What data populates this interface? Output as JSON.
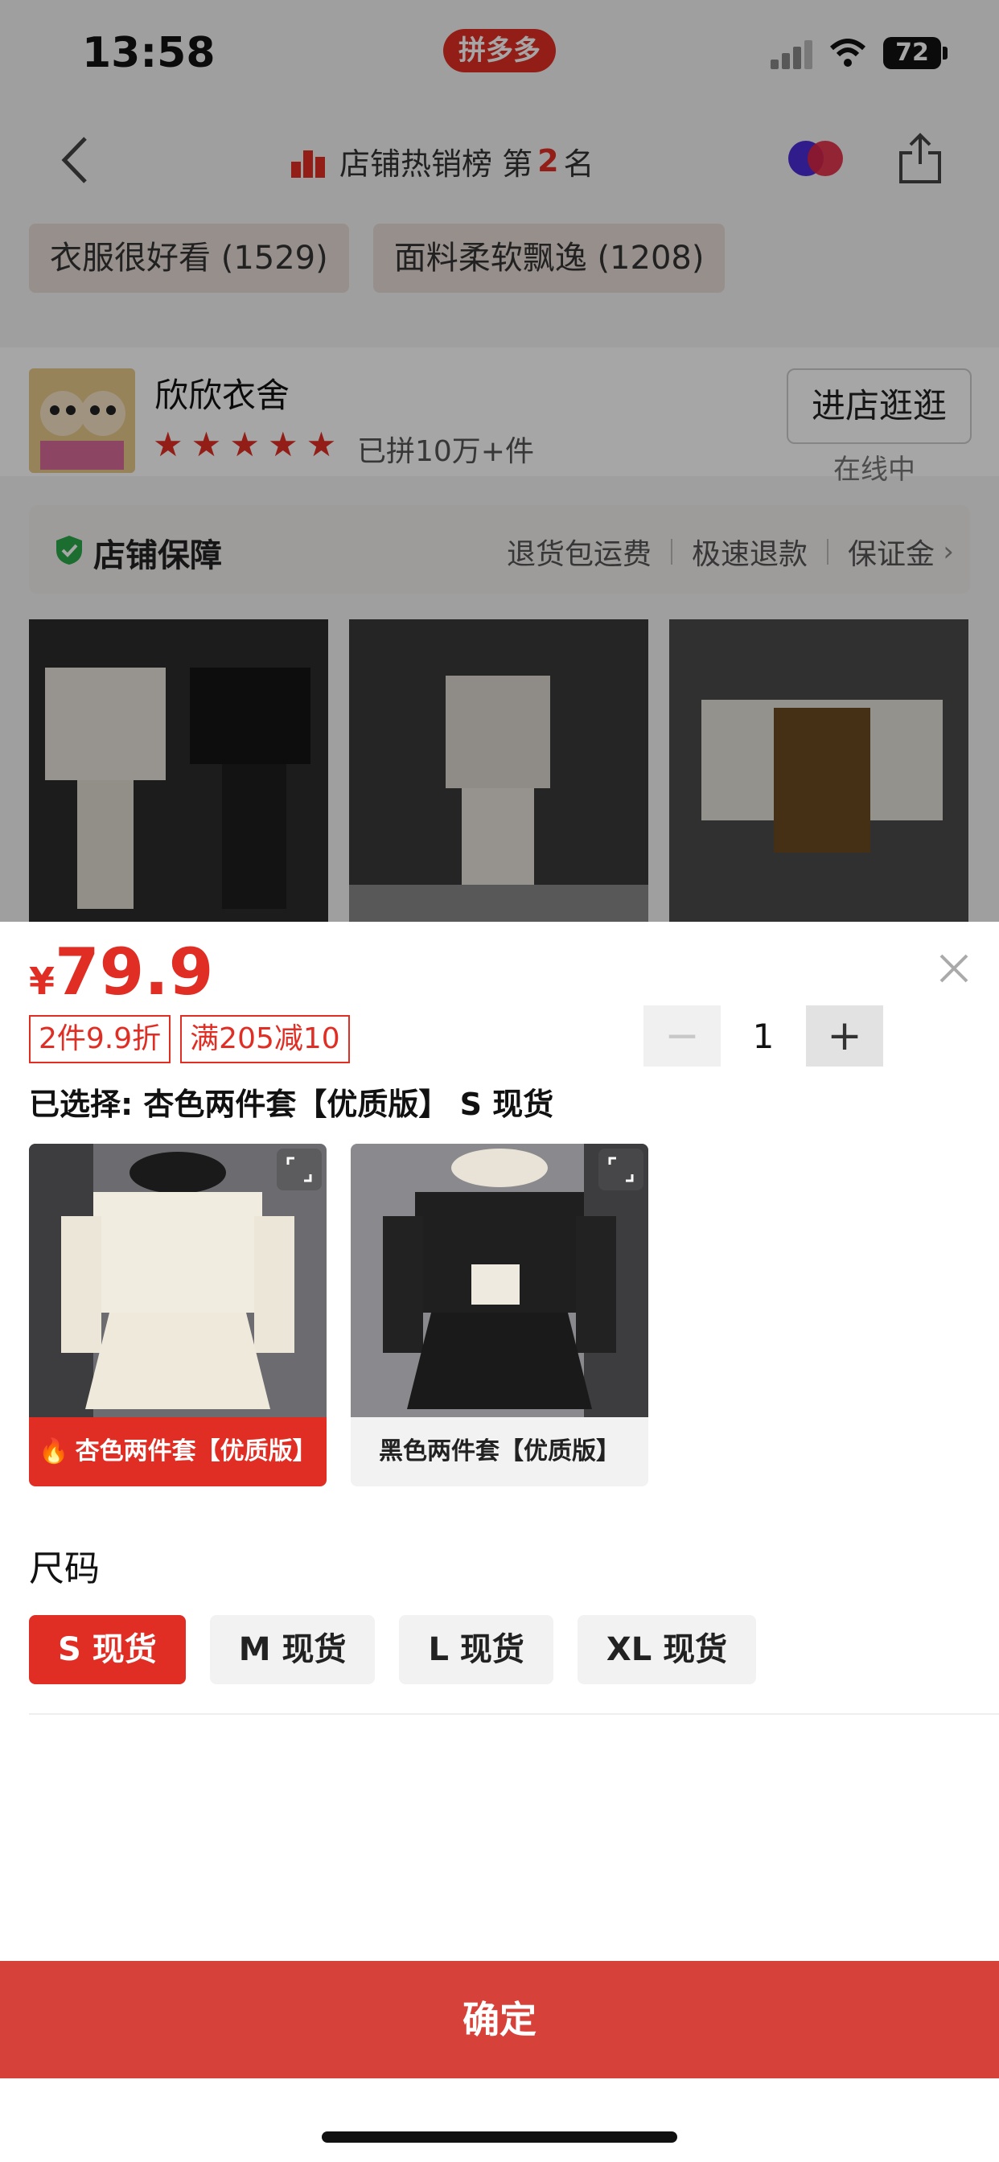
{
  "status_bar": {
    "time": "13:58",
    "app_badge": "拼多多",
    "battery": "72"
  },
  "nav": {
    "rank_label": "店铺热销榜 第",
    "rank_number": "2",
    "rank_suffix": "名"
  },
  "tags": [
    "衣服很好看 (1529)",
    "面料柔软飘逸 (1208)"
  ],
  "shop": {
    "name": "欣欣衣舍",
    "sold": "已拼10万+件",
    "enter_label": "进店逛逛",
    "online_label": "在线中",
    "rating_stars": 5
  },
  "guarantee": {
    "title": "店铺保障",
    "items": [
      "退货包运费",
      "极速退款",
      "保证金"
    ]
  },
  "sheet": {
    "currency": "¥",
    "price": "79.9",
    "promos": [
      "2件9.9折",
      "满205减10"
    ],
    "quantity": "1",
    "minus": "−",
    "plus": "+",
    "selected_text": "已选择: 杏色两件套【优质版】 S 现货",
    "variants": [
      {
        "label": "杏色两件套【优质版】",
        "state": "selected"
      },
      {
        "label": "黑色两件套【优质版】",
        "state": "unselected"
      }
    ],
    "size_title": "尺码",
    "sizes": [
      "S 现货",
      "M 现货",
      "L 现货",
      "XL 现货"
    ],
    "selected_size": "S 现货",
    "confirm_label": "确定"
  },
  "colors": {
    "accent": "#e02e24",
    "confirm": "#d6423a"
  }
}
